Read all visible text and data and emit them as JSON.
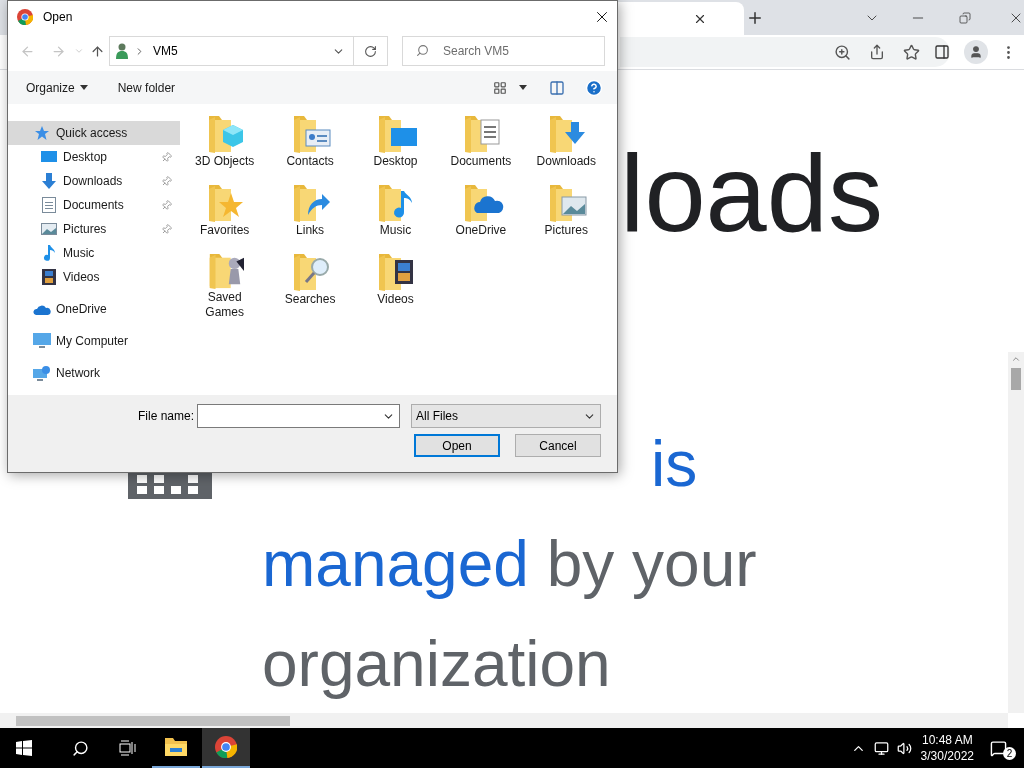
{
  "page": {
    "heading": "loads",
    "notice": [
      {
        "text": "is",
        "kind": "link"
      },
      {
        "text": "managed",
        "kind": "link"
      },
      {
        "text": " by your",
        "kind": "plain"
      },
      {
        "text": "organization",
        "kind": "plain"
      }
    ]
  },
  "dialog": {
    "title": "Open",
    "address": "VM5",
    "search_placeholder": "Search VM5",
    "commands": [
      "Organize",
      "New folder"
    ],
    "nav": [
      {
        "label": "Quick access",
        "kind": "star",
        "selected": true,
        "children": [
          {
            "label": "Desktop",
            "kind": "desktop",
            "pinned": true,
            "selected": false
          },
          {
            "label": "Downloads",
            "kind": "download",
            "pinned": true,
            "selected": false
          },
          {
            "label": "Documents",
            "kind": "document",
            "pinned": true,
            "selected": false
          },
          {
            "label": "Pictures",
            "kind": "picture",
            "pinned": true,
            "selected": false
          },
          {
            "label": "Music",
            "kind": "music",
            "pinned": false,
            "selected": false
          },
          {
            "label": "Videos",
            "kind": "video",
            "pinned": false,
            "selected": false
          }
        ]
      },
      {
        "label": "OneDrive",
        "kind": "cloud",
        "selected": false
      },
      {
        "label": "My Computer",
        "kind": "computer",
        "selected": false
      },
      {
        "label": "Network",
        "kind": "network",
        "selected": false
      }
    ],
    "folders": [
      {
        "name": "3D Objects",
        "kind": "cube"
      },
      {
        "name": "Contacts",
        "kind": "contact"
      },
      {
        "name": "Desktop",
        "kind": "desktop"
      },
      {
        "name": "Documents",
        "kind": "document"
      },
      {
        "name": "Downloads",
        "kind": "download"
      },
      {
        "name": "Favorites",
        "kind": "star"
      },
      {
        "name": "Links",
        "kind": "link"
      },
      {
        "name": "Music",
        "kind": "music"
      },
      {
        "name": "OneDrive",
        "kind": "cloud"
      },
      {
        "name": "Pictures",
        "kind": "picture"
      },
      {
        "name": "Saved Games",
        "kind": "game"
      },
      {
        "name": "Searches",
        "kind": "search"
      },
      {
        "name": "Videos",
        "kind": "video"
      }
    ],
    "file_name_label": "File name:",
    "filter": "All Files",
    "buttons": [
      {
        "label": "Open",
        "default": true
      },
      {
        "label": "Cancel",
        "default": false
      }
    ]
  },
  "taskbar": {
    "time": "10:48 AM",
    "date": "3/30/2022",
    "notifications": "2"
  }
}
